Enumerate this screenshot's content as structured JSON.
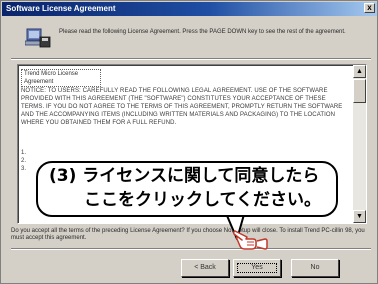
{
  "window": {
    "title": "Software License Agreement",
    "close_label": "x"
  },
  "header": {
    "instruction": "Please read the following License Agreement.  Press the PAGE DOWN key to see the rest of the agreement."
  },
  "license": {
    "section_title": "Trend Micro License Agreement",
    "body": "NOTICE: TO USERS: CAREFULLY READ THE FOLLOWING LEGAL AGREEMENT. USE OF THE SOFTWARE PROVIDED WITH THIS AGREEMENT (THE \"SOFTWARE\") CONSTITUTES YOUR ACCEPTANCE OF THESE TERMS. IF YOU DO NOT AGREE TO THE TERMS OF THIS AGREEMENT, PROMPTLY RETURN THE SOFTWARE AND THE ACCOMPANYING ITEMS (INCLUDING WRITTEN MATERIALS AND PACKAGING) TO THE LOCATION WHERE YOU OBTAINED THEM FOR A FULL REFUND.",
    "list_marks": "1.\n2.\n3."
  },
  "question": {
    "text": "Do you accept all the terms of the preceding License Agreement?  If you choose No, Setup will close.  To install Trend PC-cillin 98, you must accept this agreement."
  },
  "buttons": {
    "back": "< Back",
    "yes": "Yes",
    "no": "No"
  },
  "callout": {
    "line1": "(3) ライセンスに関して同意したら",
    "line2": "ここをクリックしてください。"
  },
  "icons": {
    "header": "computer-disk-icon",
    "pointer": "pointing-hand-icon"
  },
  "colors": {
    "titlebar": "#0a246a",
    "dialog_bg": "#d4d0c8",
    "hand_stroke": "#c0392b"
  }
}
